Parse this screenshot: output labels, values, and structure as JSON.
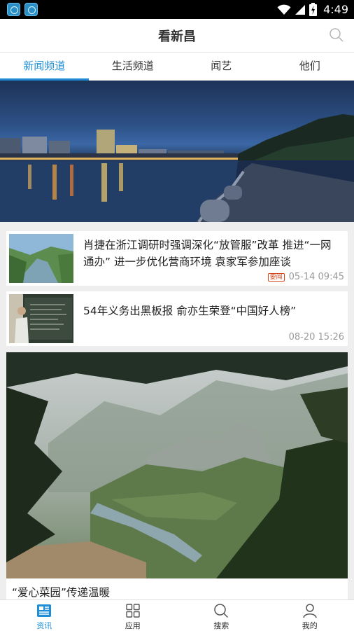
{
  "status_bar": {
    "time": "4:49"
  },
  "header": {
    "title": "看新昌",
    "search_icon": "search-icon"
  },
  "tabs": [
    {
      "label": "新闻频道",
      "active": true
    },
    {
      "label": "生活频道",
      "active": false
    },
    {
      "label": "闻艺",
      "active": false
    },
    {
      "label": "他们",
      "active": false
    }
  ],
  "news": [
    {
      "headline": "肖捷在浙江调研时强调深化“放管服”改革 推进“一网通办” 进一步优化营商环境 袁家军参加座谈",
      "tag": "要闻",
      "time": "05-14 09:45"
    },
    {
      "headline": "54年义务出黑板报 俞亦生荣登“中国好人榜”",
      "time": "08-20 15:26"
    }
  ],
  "feature": {
    "caption": "“爱心菜园”传递温暖"
  },
  "bottom_nav": [
    {
      "label": "资讯",
      "icon": "news-icon",
      "active": true
    },
    {
      "label": "应用",
      "icon": "apps-grid-icon",
      "active": false
    },
    {
      "label": "搜索",
      "icon": "search-icon",
      "active": false
    },
    {
      "label": "我的",
      "icon": "user-icon",
      "active": false
    }
  ],
  "colors": {
    "accent": "#1f8ed6",
    "tag_red": "#d6451a"
  }
}
